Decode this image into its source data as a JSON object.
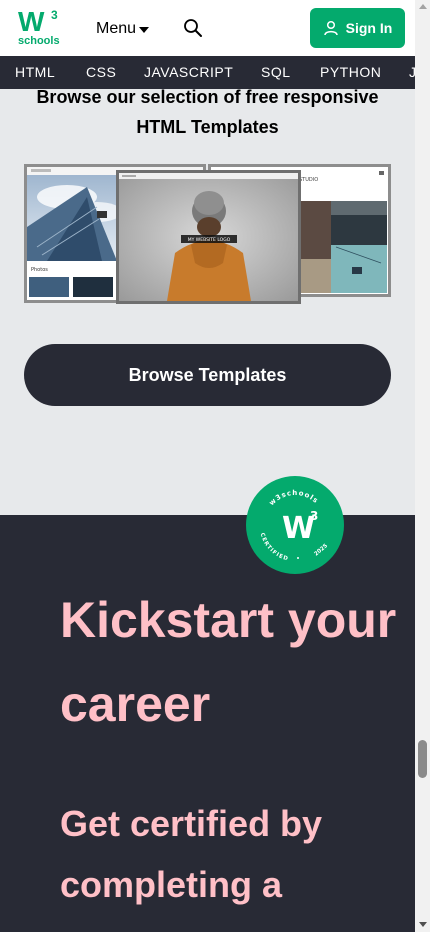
{
  "header": {
    "logo_main": "W",
    "logo_sup": "3",
    "logo_sub": "schools",
    "menu_label": "Menu",
    "signin_label": "Sign In"
  },
  "nav": {
    "items": [
      "HTML",
      "CSS",
      "JAVASCRIPT",
      "SQL",
      "PYTHON",
      "J"
    ]
  },
  "templates": {
    "title_line1": "Browse our selection of free responsive",
    "title_line2": "HTML Templates",
    "center_thumb_caption": "MY WEBSITE LOGO",
    "right_thumb_label": "STUDIO",
    "left_thumb_label": "Photos",
    "button_label": "Browse Templates"
  },
  "career": {
    "badge_top": "w3schools",
    "badge_left": "CERTIFIED",
    "badge_right": "2025",
    "badge_mark": "W",
    "badge_mark_sup": "3",
    "heading": "Kickstart your career",
    "subheading": "Get certified by completing a"
  },
  "colors": {
    "brand_green": "#04aa6d",
    "dark": "#282a35",
    "pink": "#ffc0c7",
    "light_bg": "#e7e9eb"
  }
}
